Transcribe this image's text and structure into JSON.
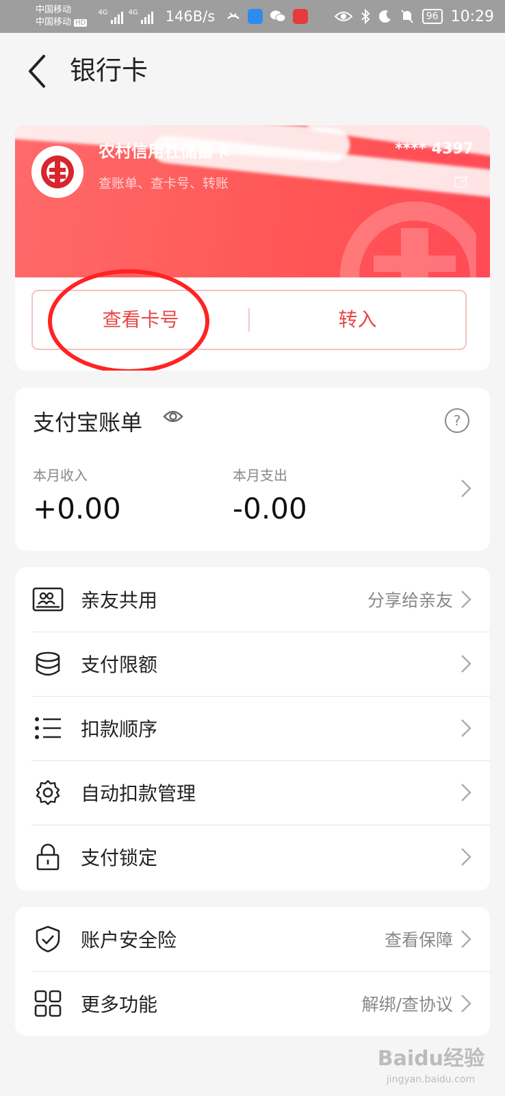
{
  "status_bar": {
    "carrier_1": "中国移动",
    "carrier_2": "中国移动",
    "hd": "HD",
    "net_type": "4G",
    "net_speed": "146B/s",
    "battery": "96",
    "time": "10:29"
  },
  "header": {
    "title": "银行卡"
  },
  "bank_card": {
    "name": "农村信用社储蓄卡",
    "subtitle": "查账单、查卡号、转账",
    "number": "**** 4397",
    "actions": {
      "view_card_number": "查看卡号",
      "transfer_in": "转入"
    }
  },
  "bill": {
    "title": "支付宝账单",
    "income_label": "本月收入",
    "income_value": "+0.00",
    "expense_label": "本月支出",
    "expense_value": "-0.00"
  },
  "menu": {
    "items": [
      {
        "label": "亲友共用",
        "right": "分享给亲友",
        "icon": "family-share-icon"
      },
      {
        "label": "支付限额",
        "right": "",
        "icon": "coins-stack-icon"
      },
      {
        "label": "扣款顺序",
        "right": "",
        "icon": "list-order-icon"
      },
      {
        "label": "自动扣款管理",
        "right": "",
        "icon": "gear-icon"
      },
      {
        "label": "支付锁定",
        "right": "",
        "icon": "lock-icon"
      }
    ]
  },
  "insurance": {
    "items": [
      {
        "label": "账户安全险",
        "right": "查看保障",
        "icon": "shield-check-icon"
      },
      {
        "label": "更多功能",
        "right": "解绑/查协议",
        "icon": "grid-icon"
      }
    ]
  },
  "watermark": {
    "logo": "Baidu经验",
    "url": "jingyan.baidu.com"
  },
  "colors": {
    "card_red": "#ff5a5a",
    "action_red": "#e64848",
    "annotation_red": "#ff2323"
  }
}
